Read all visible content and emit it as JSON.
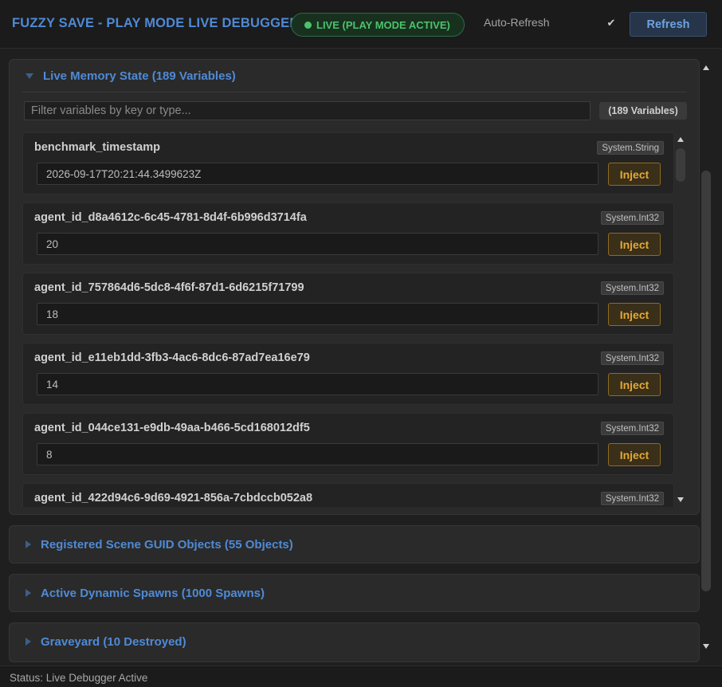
{
  "header": {
    "title": "FUZZY SAVE - PLAY MODE LIVE DEBUGGER",
    "live_badge": "LIVE (PLAY MODE ACTIVE)",
    "auto_refresh_label": "Auto-Refresh",
    "auto_refresh_checked": true,
    "refresh_label": "Refresh"
  },
  "memory_section": {
    "title": "Live Memory State (189 Variables)",
    "filter_placeholder": "Filter variables by key or type...",
    "count_badge": "(189 Variables)",
    "inject_label": "Inject",
    "variables": [
      {
        "key": "benchmark_timestamp",
        "type": "System.String",
        "value": "2026-09-17T20:21:44.3499623Z"
      },
      {
        "key": "agent_id_d8a4612c-6c45-4781-8d4f-6b996d3714fa",
        "type": "System.Int32",
        "value": "20"
      },
      {
        "key": "agent_id_757864d6-5dc8-4f6f-87d1-6d6215f71799",
        "type": "System.Int32",
        "value": "18"
      },
      {
        "key": "agent_id_e11eb1dd-3fb3-4ac6-8dc6-87ad7ea16e79",
        "type": "System.Int32",
        "value": "14"
      },
      {
        "key": "agent_id_044ce131-e9db-49aa-b466-5cd168012df5",
        "type": "System.Int32",
        "value": "8"
      },
      {
        "key": "agent_id_422d94c6-9d69-4921-856a-7cbdccb052a8",
        "type": "System.Int32",
        "value": ""
      }
    ]
  },
  "collapsed_sections": [
    {
      "title": "Registered Scene GUID Objects (55 Objects)"
    },
    {
      "title": "Active Dynamic Spawns (1000 Spawns)"
    },
    {
      "title": "Graveyard (10 Destroyed)"
    }
  ],
  "status_bar": {
    "text": "Status: Live Debugger Active"
  },
  "colors": {
    "accent_blue": "#4f8ad6",
    "live_green": "#4cc26c",
    "inject_amber": "#e2a838",
    "background": "#1f1f1f"
  }
}
